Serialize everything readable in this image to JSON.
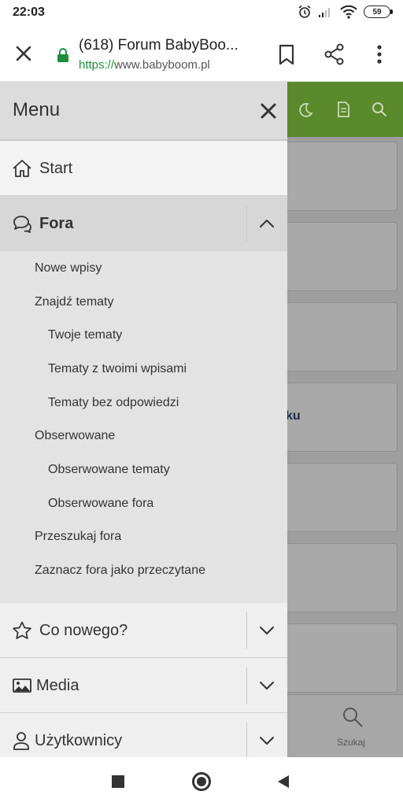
{
  "status_bar": {
    "time": "22:03",
    "battery": "59"
  },
  "browser": {
    "page_title": "(618) Forum BabyBoo...",
    "url_scheme": "https://",
    "url_host": "www.babyboom.pl"
  },
  "background_page": {
    "card_text": "ku",
    "search_label": "Szukaj",
    "header_color": "#5a8a2b"
  },
  "drawer": {
    "title": "Menu",
    "items": {
      "start": "Start",
      "fora": "Fora",
      "co_nowego": "Co nowego?",
      "media": "Media",
      "uzytkownicy": "Użytkownicy"
    },
    "fora_sub": [
      "Nowe wpisy",
      "Znajdź tematy",
      "Twoje tematy",
      "Tematy z twoimi wpisami",
      "Tematy bez odpowiedzi",
      "Obserwowane",
      "Obserwowane tematy",
      "Obserwowane fora",
      "Przeszukaj fora",
      "Zaznacz fora jako przeczytane"
    ]
  }
}
